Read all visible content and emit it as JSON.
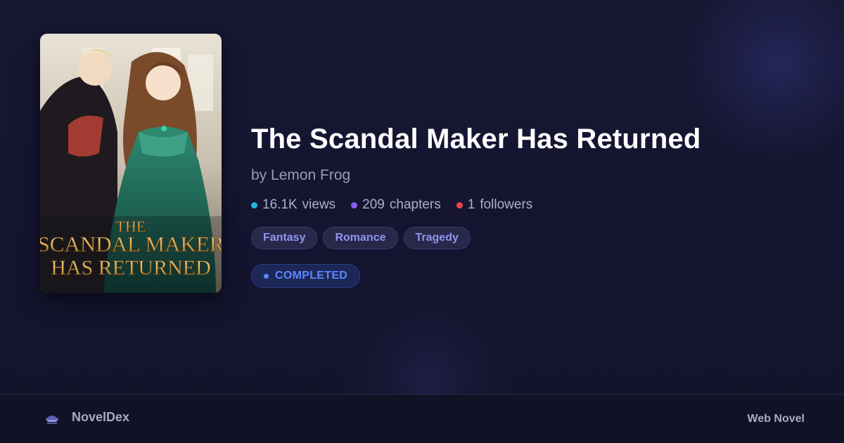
{
  "novel": {
    "title": "The Scandal Maker Has Returned",
    "author": "by Lemon Frog",
    "cover": {
      "title_line1": "THE",
      "title_line2": "SCANDAL MAKER",
      "title_line3": "HAS RETURNED"
    },
    "stats": {
      "views": {
        "value": "16.1K",
        "label": "views",
        "color": "#22b7e0"
      },
      "chapters": {
        "value": "209",
        "label": "chapters",
        "color": "#8b5cf6"
      },
      "followers": {
        "value": "1",
        "label": "followers",
        "color": "#ef4444"
      }
    },
    "tags": [
      "Fantasy",
      "Romance",
      "Tragedy"
    ],
    "status": "COMPLETED"
  },
  "footer": {
    "brand": "NovelDex",
    "platform": "Web Novel"
  },
  "colors": {
    "background": "#14142b",
    "tag_text": "#8f96f0",
    "status_accent": "#5c87ff"
  }
}
